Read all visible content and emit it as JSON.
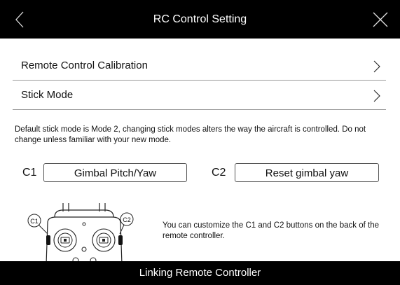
{
  "header": {
    "title": "RC Control Setting",
    "back_icon": "chevron-left-icon",
    "close_icon": "close-icon"
  },
  "menu": [
    {
      "label": "Remote Control Calibration",
      "icon": "chevron-right-icon"
    },
    {
      "label": "Stick Mode",
      "icon": "chevron-right-icon"
    }
  ],
  "note": "Default stick mode is Mode 2, changing stick modes alters the way the aircraft is controlled. Do not change unless familiar with your new mode.",
  "custom_buttons": {
    "c1": {
      "label": "C1",
      "value": "Gimbal Pitch/Yaw"
    },
    "c2": {
      "label": "C2",
      "value": "Reset gimbal yaw"
    }
  },
  "diagram": {
    "c1_tag": "C1",
    "c2_tag": "C2"
  },
  "info": "You can customize the C1 and C2 buttons on the back of the remote controller.",
  "footer": {
    "label": "Linking Remote Controller"
  }
}
